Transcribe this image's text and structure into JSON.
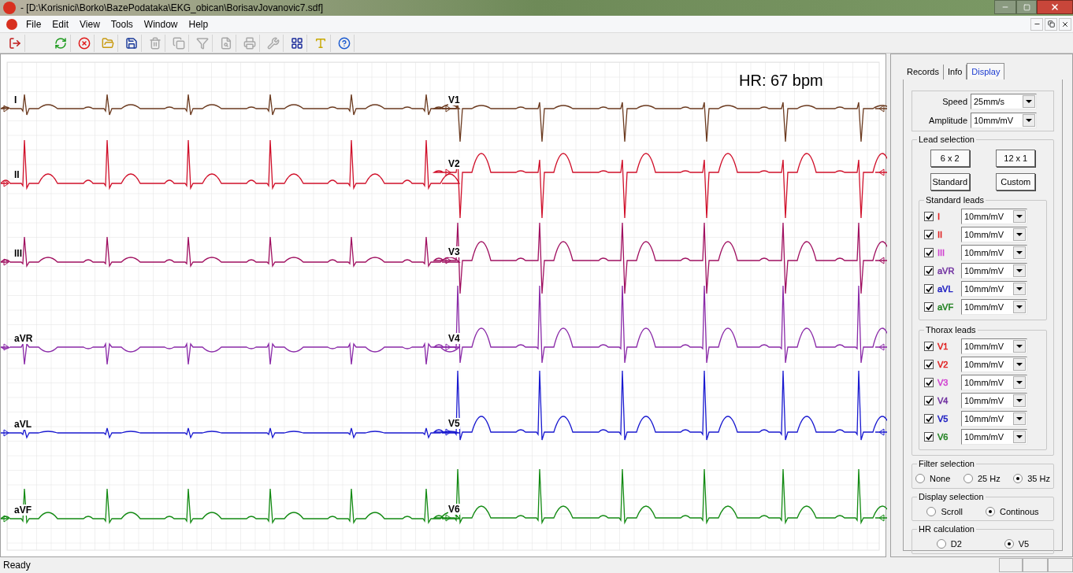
{
  "window": {
    "title": "- [D:\\Korisnici\\Borko\\BazePodataka\\EKG_obican\\BorisavJovanovic7.sdf]"
  },
  "menu": [
    "File",
    "Edit",
    "View",
    "Tools",
    "Window",
    "Help"
  ],
  "toolbar": [
    {
      "kind": "exit",
      "disabled": false
    },
    {
      "kind": "separator"
    },
    {
      "kind": "refresh",
      "disabled": false
    },
    {
      "kind": "stop",
      "disabled": false
    },
    {
      "kind": "open",
      "disabled": false
    },
    {
      "kind": "save",
      "disabled": false
    },
    {
      "kind": "delete",
      "disabled": true
    },
    {
      "kind": "copy",
      "disabled": true
    },
    {
      "kind": "filter",
      "disabled": true
    },
    {
      "kind": "preview",
      "disabled": true
    },
    {
      "kind": "print",
      "disabled": true
    },
    {
      "kind": "tools",
      "disabled": true
    },
    {
      "kind": "grid",
      "disabled": false
    },
    {
      "kind": "font",
      "disabled": false
    },
    {
      "kind": "help",
      "disabled": false
    }
  ],
  "ecg": {
    "hr": "HR: 67 bpm",
    "left_leads": [
      {
        "label": "I",
        "color": "#6b3a1f",
        "kind": "i"
      },
      {
        "label": "II",
        "color": "#d0102a",
        "kind": "ii"
      },
      {
        "label": "III",
        "color": "#a01060",
        "kind": "iii"
      },
      {
        "label": "aVR",
        "color": "#8a2aa8",
        "kind": "avr"
      },
      {
        "label": "aVL",
        "color": "#1a1ad0",
        "kind": "avl"
      },
      {
        "label": "aVF",
        "color": "#138a13",
        "kind": "avf"
      }
    ],
    "right_leads": [
      {
        "label": "V1",
        "color": "#6b3a1f",
        "kind": "v1"
      },
      {
        "label": "V2",
        "color": "#d0102a",
        "kind": "v2"
      },
      {
        "label": "V3",
        "color": "#a01060",
        "kind": "v3"
      },
      {
        "label": "V4",
        "color": "#8a2aa8",
        "kind": "v4"
      },
      {
        "label": "V5",
        "color": "#1a1ad0",
        "kind": "v5"
      },
      {
        "label": "V6",
        "color": "#138a13",
        "kind": "v6"
      }
    ]
  },
  "panel": {
    "tabs": [
      {
        "label": "Records",
        "selected": false
      },
      {
        "label": "Info",
        "selected": false
      },
      {
        "label": "Display",
        "selected": true
      }
    ],
    "speed": {
      "label": "Speed",
      "value": "25mm/s"
    },
    "amplitude": {
      "label": "Amplitude",
      "value": "10mm/mV"
    },
    "lead_selection": {
      "title": "Lead selection",
      "buttons": [
        "6 x 2",
        "12 x 1",
        "Standard",
        "Custom"
      ]
    },
    "standard_leads": {
      "title": "Standard leads",
      "items": [
        {
          "label": "I",
          "color": "#e02020",
          "checked": true,
          "value": "10mm/mV"
        },
        {
          "label": "II",
          "color": "#e02020",
          "checked": true,
          "value": "10mm/mV"
        },
        {
          "label": "III",
          "color": "#d040d0",
          "checked": true,
          "value": "10mm/mV"
        },
        {
          "label": "aVR",
          "color": "#7030a0",
          "checked": true,
          "value": "10mm/mV"
        },
        {
          "label": "aVL",
          "color": "#1818c0",
          "checked": true,
          "value": "10mm/mV"
        },
        {
          "label": "aVF",
          "color": "#208020",
          "checked": true,
          "value": "10mm/mV"
        }
      ]
    },
    "thorax_leads": {
      "title": "Thorax leads",
      "items": [
        {
          "label": "V1",
          "color": "#e02020",
          "checked": true,
          "value": "10mm/mV"
        },
        {
          "label": "V2",
          "color": "#e02020",
          "checked": true,
          "value": "10mm/mV"
        },
        {
          "label": "V3",
          "color": "#d040d0",
          "checked": true,
          "value": "10mm/mV"
        },
        {
          "label": "V4",
          "color": "#7030a0",
          "checked": true,
          "value": "10mm/mV"
        },
        {
          "label": "V5",
          "color": "#1818c0",
          "checked": true,
          "value": "10mm/mV"
        },
        {
          "label": "V6",
          "color": "#208020",
          "checked": true,
          "value": "10mm/mV"
        }
      ]
    },
    "filter_selection": {
      "title": "Filter selection",
      "options": [
        {
          "label": "None",
          "selected": false
        },
        {
          "label": "25 Hz",
          "selected": false
        },
        {
          "label": "35 Hz",
          "selected": true
        }
      ]
    },
    "display_selection": {
      "title": "Display selection",
      "options": [
        {
          "label": "Scroll",
          "selected": false
        },
        {
          "label": "Continous",
          "selected": true
        }
      ]
    },
    "hr_calculation": {
      "title": "HR calculation",
      "options": [
        {
          "label": "D2",
          "selected": false
        },
        {
          "label": "V5",
          "selected": true
        }
      ]
    }
  },
  "status_bar": {
    "text": "Ready"
  }
}
